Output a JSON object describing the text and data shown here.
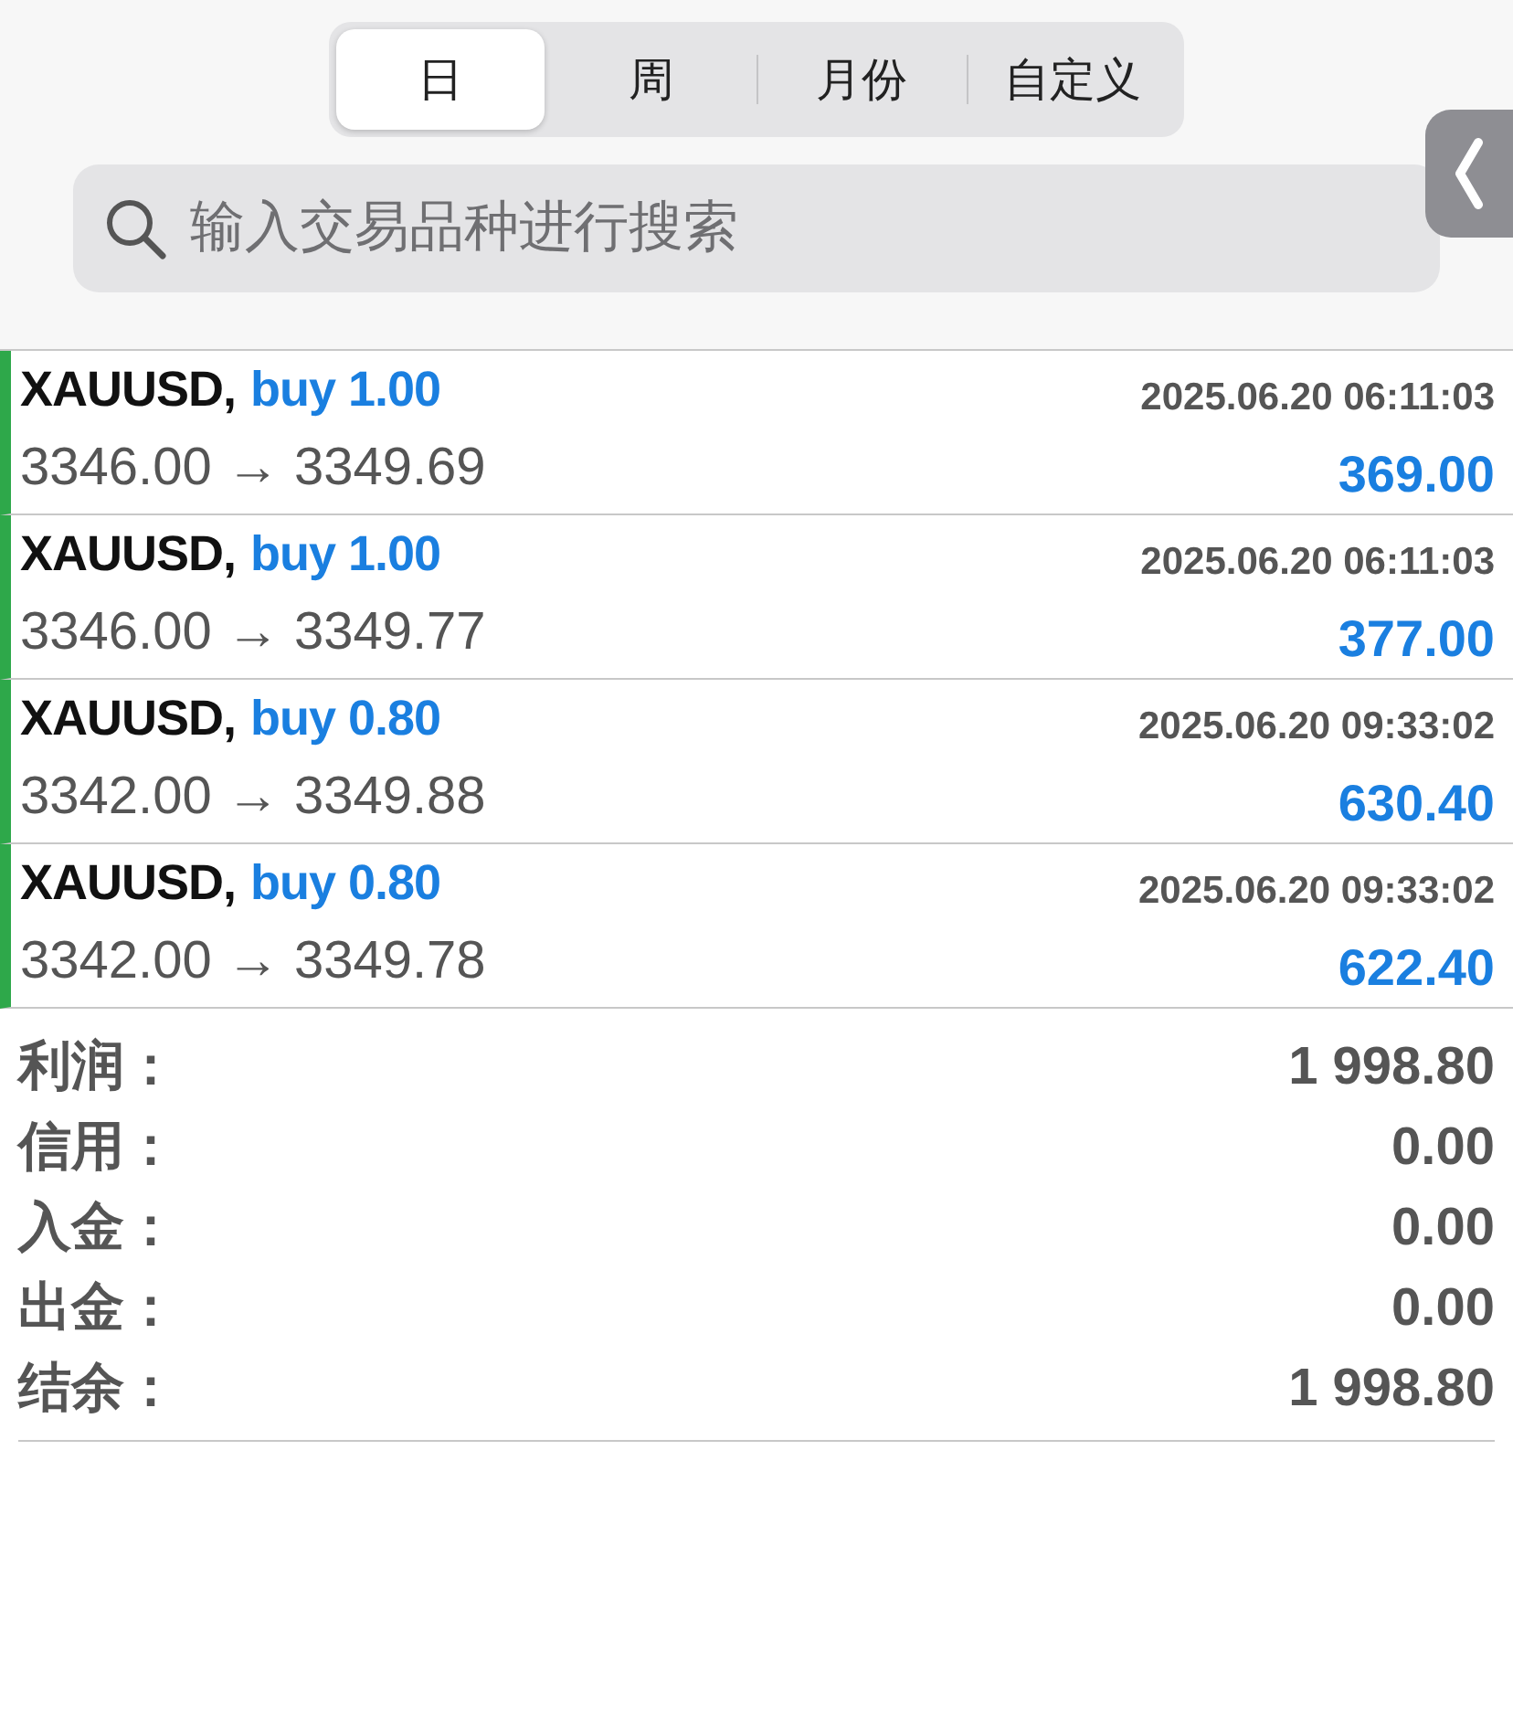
{
  "tabs": [
    {
      "label": "日",
      "selected": true
    },
    {
      "label": "周",
      "selected": false
    },
    {
      "label": "月份",
      "selected": false
    },
    {
      "label": "自定义",
      "selected": false
    }
  ],
  "search": {
    "placeholder": "输入交易品种进行搜索"
  },
  "trades": [
    {
      "symbol": "XAUUSD,",
      "order": "buy 1.00",
      "time": "2025.06.20 06:11:03",
      "prices": "3346.00 → 3349.69",
      "profit": "369.00"
    },
    {
      "symbol": "XAUUSD,",
      "order": "buy 1.00",
      "time": "2025.06.20 06:11:03",
      "prices": "3346.00 → 3349.77",
      "profit": "377.00"
    },
    {
      "symbol": "XAUUSD,",
      "order": "buy 0.80",
      "time": "2025.06.20 09:33:02",
      "prices": "3342.00 → 3349.88",
      "profit": "630.40"
    },
    {
      "symbol": "XAUUSD,",
      "order": "buy 0.80",
      "time": "2025.06.20 09:33:02",
      "prices": "3342.00 → 3349.78",
      "profit": "622.40"
    }
  ],
  "summary": [
    {
      "label": "利润：",
      "value": "1 998.80"
    },
    {
      "label": "信用：",
      "value": "0.00"
    },
    {
      "label": "入金：",
      "value": "0.00"
    },
    {
      "label": "出金：",
      "value": "0.00"
    },
    {
      "label": "结余：",
      "value": "1 998.80"
    }
  ]
}
